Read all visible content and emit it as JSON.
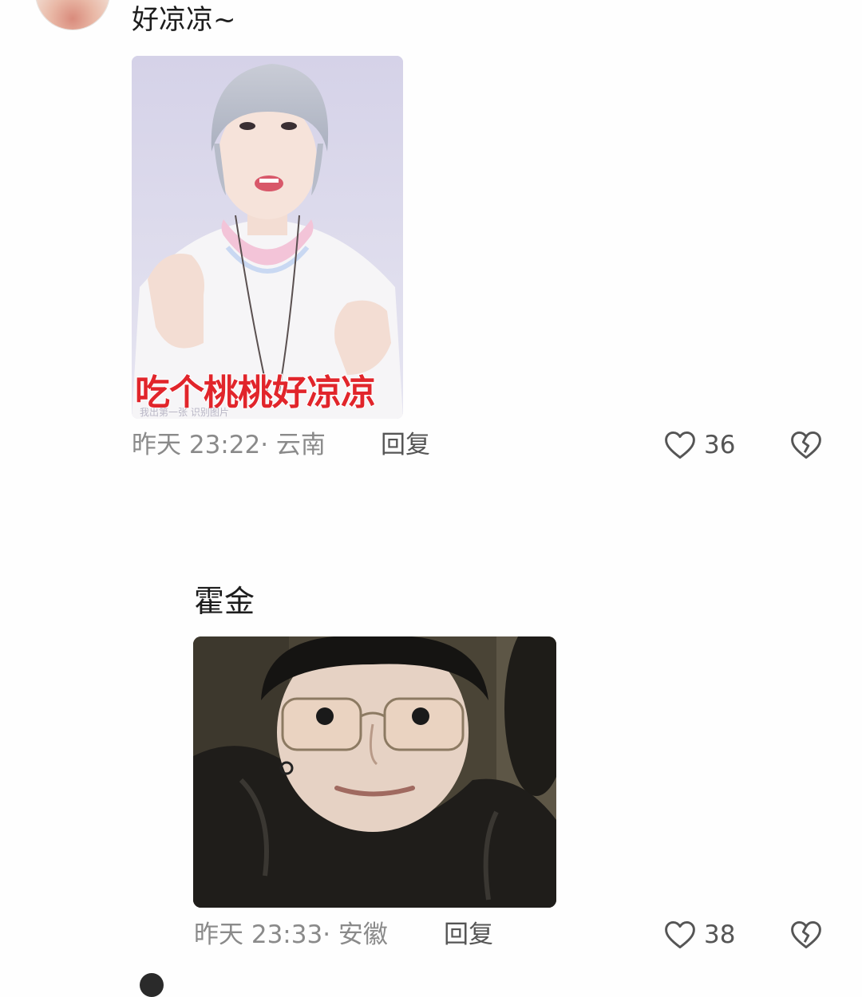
{
  "comments": [
    {
      "text": "好凉凉~",
      "image_caption": "吃个桃桃好凉凉",
      "image_watermark": "我出第一张  识别图片",
      "time": "昨天 23:22",
      "location_sep": "·",
      "location": "云南",
      "reply_label": "回复",
      "likes": "36"
    },
    {
      "text": "霍金",
      "time": "昨天 23:33",
      "location_sep": "·",
      "location": "安徽",
      "reply_label": "回复",
      "likes": "38"
    }
  ],
  "icons": {
    "like": "heart-outline-icon",
    "dislike": "broken-heart-icon"
  },
  "colors": {
    "caption_red": "#e1252b",
    "meta_gray": "#8a8a8a",
    "reply_gray": "#555555",
    "background": "#fefefe"
  }
}
